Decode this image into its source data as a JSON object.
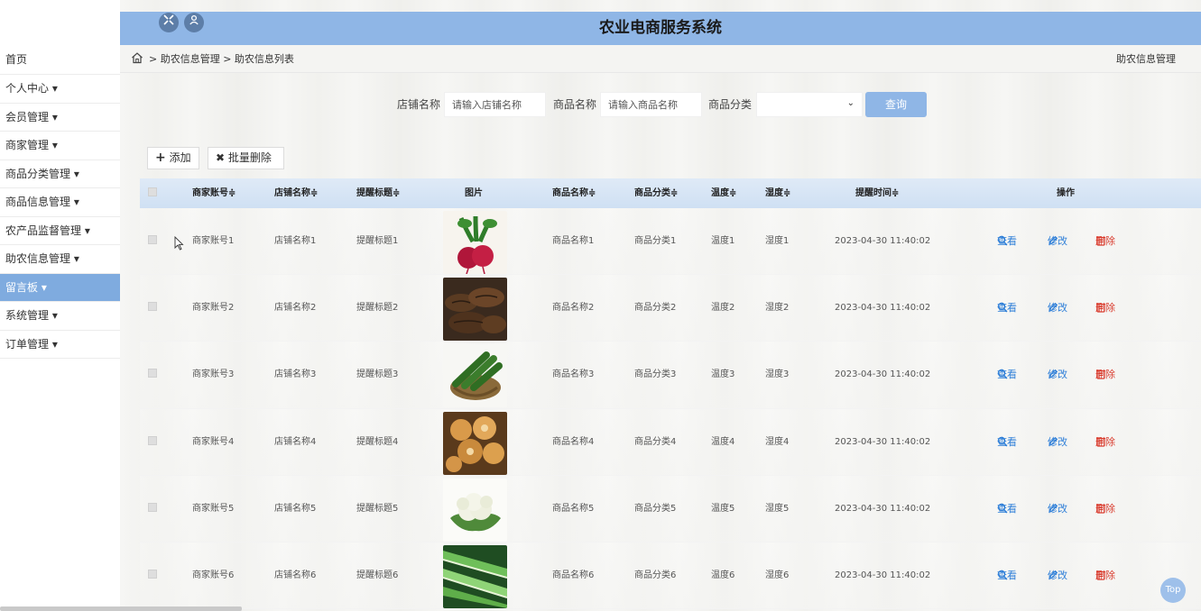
{
  "app": {
    "title": "农业电商服务系统"
  },
  "sidebar": {
    "items": [
      {
        "label": "首页",
        "active": false
      },
      {
        "label": "个人中心 ▾",
        "active": false
      },
      {
        "label": "会员管理 ▾",
        "active": false
      },
      {
        "label": "商家管理 ▾",
        "active": false
      },
      {
        "label": "商品分类管理 ▾",
        "active": false
      },
      {
        "label": "商品信息管理 ▾",
        "active": false
      },
      {
        "label": "农产品监督管理 ▾",
        "active": false
      },
      {
        "label": "助农信息管理 ▾",
        "active": false
      },
      {
        "label": "留言板 ▾",
        "active": true
      },
      {
        "label": "系统管理 ▾",
        "active": false
      },
      {
        "label": "订单管理 ▾",
        "active": false
      }
    ]
  },
  "breadcrumb": {
    "path": "> 助农信息管理 > 助农信息列表",
    "right": "助农信息管理"
  },
  "search": {
    "shop_label": "店铺名称",
    "shop_placeholder": "请输入店铺名称",
    "product_label": "商品名称",
    "product_placeholder": "请输入商品名称",
    "category_label": "商品分类",
    "category_value": "",
    "query_label": "查询"
  },
  "actions": {
    "add_label": "添加",
    "batch_delete_label": "批量删除"
  },
  "table": {
    "columns": [
      "商家账号≑",
      "店铺名称≑",
      "提醒标题≑",
      "图片",
      "商品名称≑",
      "商品分类≑",
      "温度≑",
      "湿度≑",
      "提醒时间≑",
      "操作"
    ],
    "op_labels": {
      "view": "查看",
      "edit": "修改",
      "delete": "删除"
    },
    "rows": [
      {
        "account": "商家账号1",
        "shop": "店铺名称1",
        "title": "提醒标题1",
        "image": "radish-icon",
        "product": "商品名称1",
        "category": "商品分类1",
        "temperature": "温度1",
        "humidity": "湿度1",
        "time": "2023-04-30 11:40:02"
      },
      {
        "account": "商家账号2",
        "shop": "店铺名称2",
        "title": "提醒标题2",
        "image": "dried-mushroom-icon",
        "product": "商品名称2",
        "category": "商品分类2",
        "temperature": "温度2",
        "humidity": "湿度2",
        "time": "2023-04-30 11:40:02"
      },
      {
        "account": "商家账号3",
        "shop": "店铺名称3",
        "title": "提醒标题3",
        "image": "cucumber-basket-icon",
        "product": "商品名称3",
        "category": "商品分类3",
        "temperature": "温度3",
        "humidity": "湿度3",
        "time": "2023-04-30 11:40:02"
      },
      {
        "account": "商家账号4",
        "shop": "店铺名称4",
        "title": "提醒标题4",
        "image": "dried-fruit-icon",
        "product": "商品名称4",
        "category": "商品分类4",
        "temperature": "温度4",
        "humidity": "湿度4",
        "time": "2023-04-30 11:40:02"
      },
      {
        "account": "商家账号5",
        "shop": "店铺名称5",
        "title": "提醒标题5",
        "image": "cauliflower-icon",
        "product": "商品名称5",
        "category": "商品分类5",
        "temperature": "温度5",
        "humidity": "湿度5",
        "time": "2023-04-30 11:40:02"
      },
      {
        "account": "商家账号6",
        "shop": "店铺名称6",
        "title": "提醒标题6",
        "image": "leek-icon",
        "product": "商品名称6",
        "category": "商品分类6",
        "temperature": "温度6",
        "humidity": "湿度6",
        "time": "2023-04-30 11:40:02"
      }
    ]
  },
  "top_button": {
    "label": "Top"
  },
  "colors": {
    "accent": "#8fb6e6",
    "sidebar_active": "#7fabdf",
    "view": "#2f7fd8",
    "delete": "#d93c2e"
  }
}
